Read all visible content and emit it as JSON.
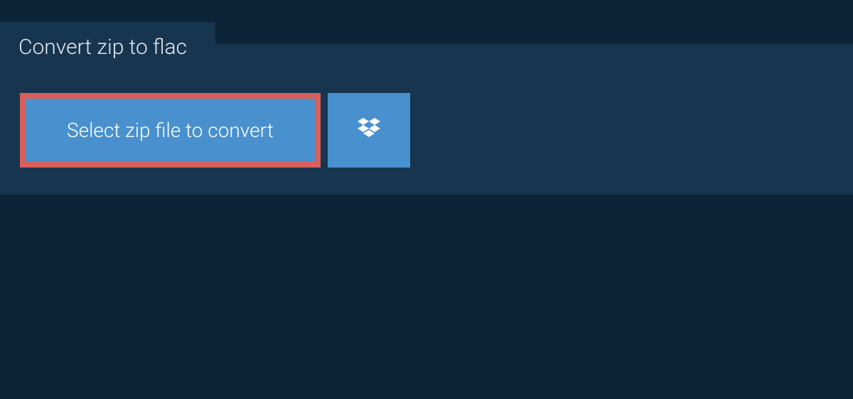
{
  "tab": {
    "title": "Convert zip to flac"
  },
  "actions": {
    "select_label": "Select zip file to convert"
  }
}
